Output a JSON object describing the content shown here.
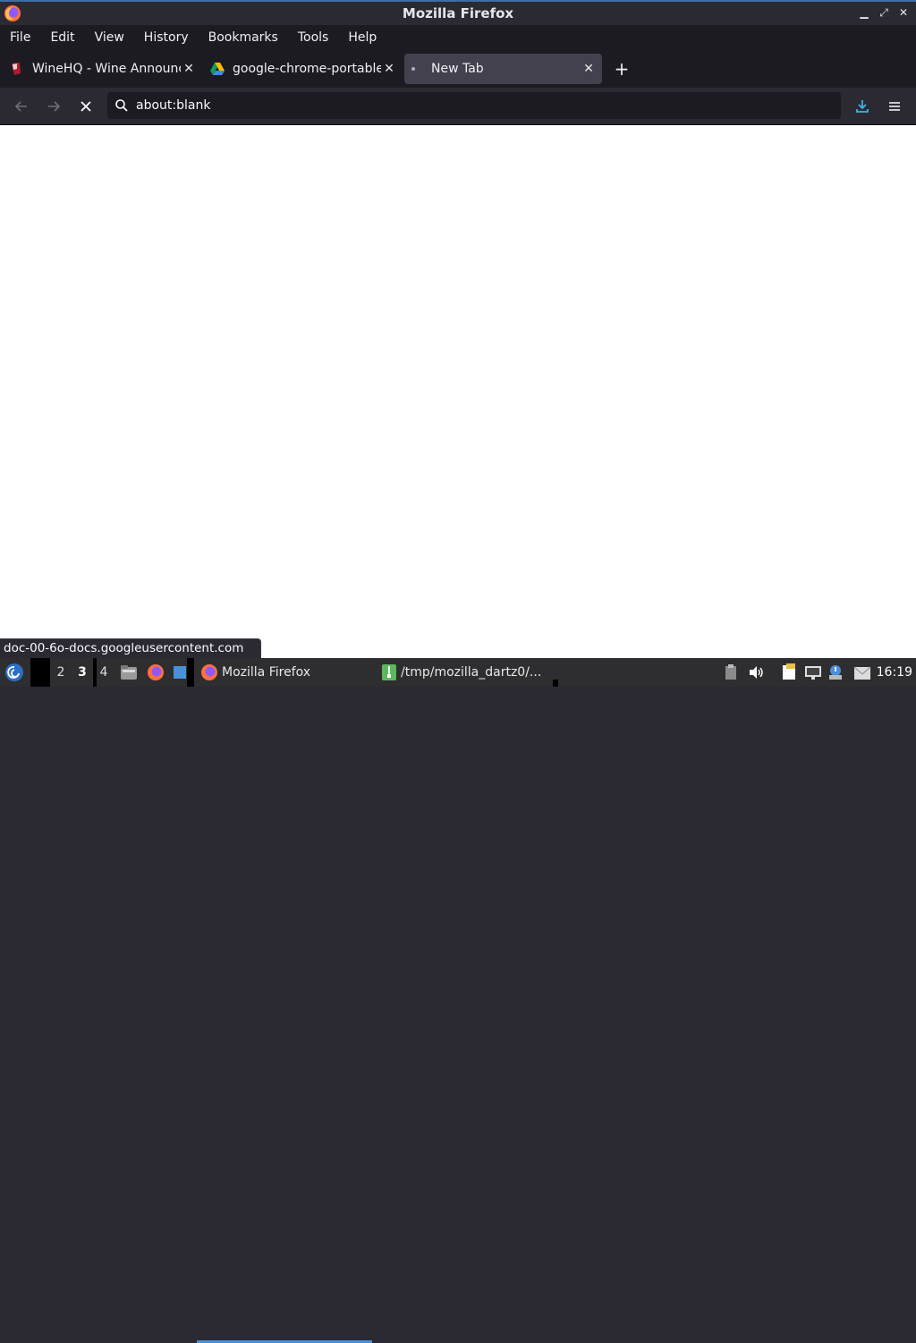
{
  "window": {
    "title": "Mozilla Firefox"
  },
  "menu": {
    "items": [
      {
        "label": "File"
      },
      {
        "label": "Edit"
      },
      {
        "label": "View"
      },
      {
        "label": "History"
      },
      {
        "label": "Bookmarks"
      },
      {
        "label": "Tools"
      },
      {
        "label": "Help"
      }
    ]
  },
  "tabs": [
    {
      "label": "WineHQ - Wine Announce",
      "icon": "winehq-favicon",
      "active": false
    },
    {
      "label": "google-chrome-portable-",
      "icon": "google-drive-favicon",
      "active": false
    },
    {
      "label": "New Tab",
      "icon": "loading-dot",
      "active": true
    }
  ],
  "navbar": {
    "url": "about:blank"
  },
  "status": {
    "text": "doc-00-6o-docs.googleusercontent.com"
  },
  "taskbar": {
    "workspaces": [
      "2",
      "3",
      "4"
    ],
    "current_workspace": "3",
    "tasks": [
      {
        "label": "Mozilla Firefox",
        "icon": "firefox-icon",
        "active": true
      },
      {
        "label": "/tmp/mozilla_dartz0/...",
        "icon": "archive-icon",
        "active": false
      }
    ],
    "clock": "16:19"
  },
  "colors": {
    "accent": "#4a90d9",
    "download": "#3fb6e8"
  }
}
